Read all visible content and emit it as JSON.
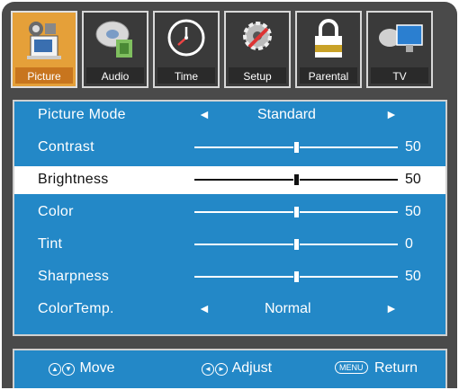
{
  "tabs": [
    {
      "label": "Picture",
      "icon": "tv-camera-icon",
      "active": true
    },
    {
      "label": "Audio",
      "icon": "speaker-disc-icon",
      "active": false
    },
    {
      "label": "Time",
      "icon": "clock-icon",
      "active": false
    },
    {
      "label": "Setup",
      "icon": "gear-wrench-icon",
      "active": false
    },
    {
      "label": "Parental",
      "icon": "padlock-icon",
      "active": false
    },
    {
      "label": "TV",
      "icon": "satellite-monitor-icon",
      "active": false
    }
  ],
  "menu": {
    "picture_mode": {
      "label": "Picture Mode",
      "value": "Standard"
    },
    "contrast": {
      "label": "Contrast",
      "value": "50",
      "level": 0.5
    },
    "brightness": {
      "label": "Brightness",
      "value": "50",
      "level": 0.5
    },
    "color": {
      "label": "Color",
      "value": "50",
      "level": 0.5
    },
    "tint": {
      "label": "Tint",
      "value": "0",
      "level": 0.5
    },
    "sharpness": {
      "label": "Sharpness",
      "value": "50",
      "level": 0.5
    },
    "color_temp": {
      "label": "ColorTemp.",
      "value": "Normal"
    },
    "arrow_left": "◄",
    "arrow_right": "►"
  },
  "footer": {
    "move": "Move",
    "adjust": "Adjust",
    "menu_key": "MENU",
    "return": "Return"
  },
  "colors": {
    "panel": "#2388c7",
    "active_tab": "#e5a039",
    "frame": "#4a4a4a"
  }
}
